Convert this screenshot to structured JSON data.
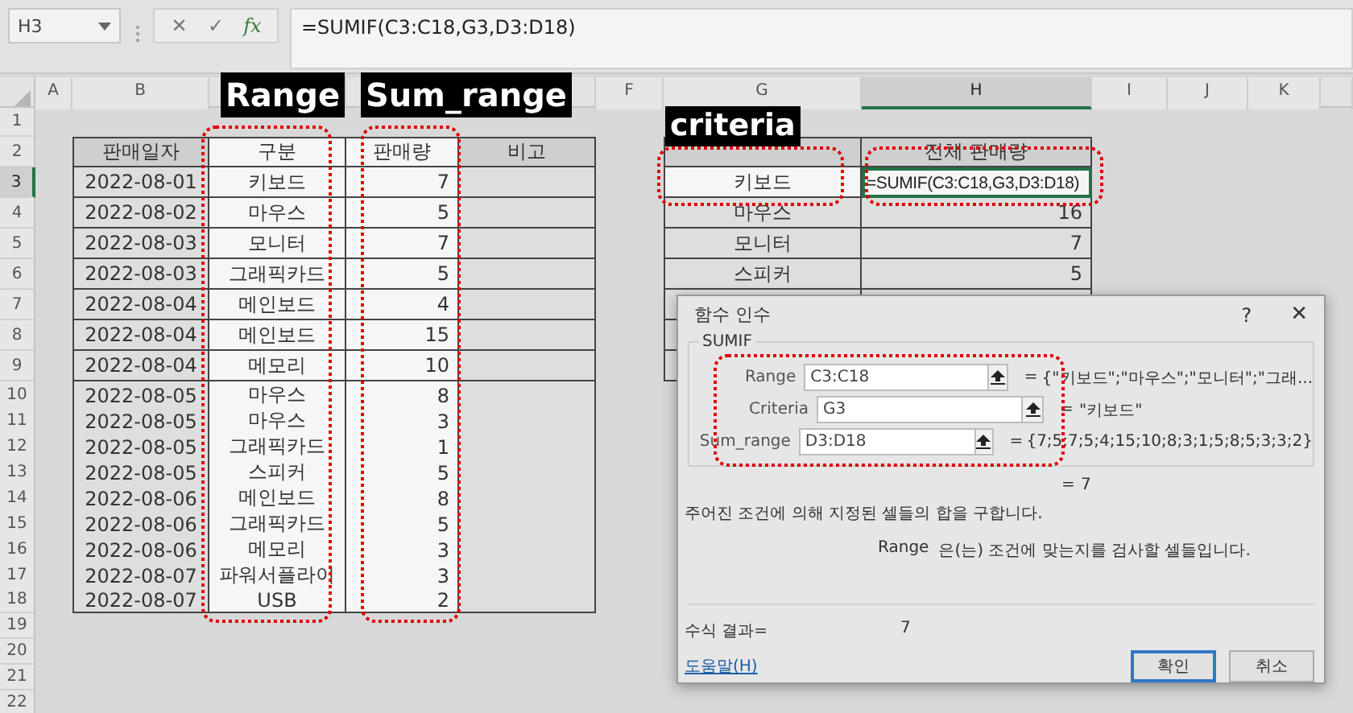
{
  "formula_bar": {
    "name_box": "H3",
    "cancel": "✕",
    "enter": "✓",
    "insert_function": "fx",
    "formula": "=SUMIF(C3:C18,G3,D3:D18)"
  },
  "columns": [
    {
      "label": "A",
      "selected": false
    },
    {
      "label": "B",
      "selected": false
    },
    {
      "label": "F",
      "selected": false
    },
    {
      "label": "G",
      "selected": false
    },
    {
      "label": "H",
      "selected": true
    },
    {
      "label": "I",
      "selected": false
    },
    {
      "label": "J",
      "selected": false
    },
    {
      "label": "K",
      "selected": false
    }
  ],
  "rows": [
    {
      "label": "1",
      "selected": false
    },
    {
      "label": "2",
      "selected": false
    },
    {
      "label": "3",
      "selected": true
    },
    {
      "label": "4",
      "selected": false
    },
    {
      "label": "5",
      "selected": false
    },
    {
      "label": "6",
      "selected": false
    },
    {
      "label": "7",
      "selected": false
    },
    {
      "label": "8",
      "selected": false
    },
    {
      "label": "9",
      "selected": false
    },
    {
      "label": "10",
      "selected": false
    },
    {
      "label": "11",
      "selected": false
    },
    {
      "label": "12",
      "selected": false
    },
    {
      "label": "13",
      "selected": false
    },
    {
      "label": "14",
      "selected": false
    },
    {
      "label": "15",
      "selected": false
    },
    {
      "label": "16",
      "selected": false
    },
    {
      "label": "17",
      "selected": false
    },
    {
      "label": "18",
      "selected": false
    },
    {
      "label": "19",
      "selected": false
    },
    {
      "label": "20",
      "selected": false
    },
    {
      "label": "21",
      "selected": false
    },
    {
      "label": "22",
      "selected": false
    }
  ],
  "sales_table": {
    "columns": [
      {
        "header": "판매일자",
        "referenced": false
      },
      {
        "header": "구분",
        "referenced": true
      },
      {
        "header": "판매량",
        "referenced": true
      },
      {
        "header": "비고",
        "referenced": false
      }
    ],
    "rows": [
      [
        "2022-08-01",
        "키보드",
        "7"
      ],
      [
        "2022-08-02",
        "마우스",
        "5"
      ],
      [
        "2022-08-03",
        "모니터",
        "7"
      ],
      [
        "2022-08-03",
        "그래픽카드",
        "5"
      ],
      [
        "2022-08-04",
        "메인보드",
        "4"
      ],
      [
        "2022-08-04",
        "메인보드",
        "15"
      ],
      [
        "2022-08-04",
        "메모리",
        "10"
      ],
      [
        "2022-08-05",
        "마우스",
        "8"
      ],
      [
        "2022-08-05",
        "마우스",
        "3"
      ],
      [
        "2022-08-05",
        "그래픽카드",
        "1"
      ],
      [
        "2022-08-05",
        "스피커",
        "5"
      ],
      [
        "2022-08-06",
        "메인보드",
        "8"
      ],
      [
        "2022-08-06",
        "그래픽카드",
        "5"
      ],
      [
        "2022-08-06",
        "메모리",
        "3"
      ],
      [
        "2022-08-07",
        "파워서플라이",
        "3"
      ],
      [
        "2022-08-07",
        "USB",
        "2"
      ]
    ]
  },
  "summary_table": {
    "headers": [
      "전체 판매량"
    ],
    "rows": [
      [
        {
          "text": "키보드",
          "referenced": true,
          "editing": false
        },
        {
          "text": "=SUMIF(C3:C18,G3,D3:D18)",
          "referenced": false,
          "editing": true
        }
      ],
      [
        {
          "text": "마우스",
          "referenced": false,
          "editing": false
        },
        {
          "text": "16",
          "referenced": false,
          "editing": false
        }
      ],
      [
        {
          "text": "모니터",
          "referenced": false,
          "editing": false
        },
        {
          "text": "7",
          "referenced": false,
          "editing": false
        }
      ],
      [
        {
          "text": "스피커",
          "referenced": false,
          "editing": false
        },
        {
          "text": "5",
          "referenced": false,
          "editing": false
        }
      ]
    ]
  },
  "annotations": [
    {
      "text": "Range",
      "kind": "column"
    },
    {
      "text": "Sum_range",
      "kind": "column"
    },
    {
      "text": "criteria",
      "kind": "cell"
    }
  ],
  "dialog": {
    "title": "함수 인수",
    "help": "?",
    "close": "✕",
    "function": "SUMIF",
    "arguments": [
      {
        "label": "Range",
        "value": "C3:C18",
        "sign": "=",
        "result": "{\"키보드\";\"마우스\";\"모니터\";\"그래..."
      },
      {
        "label": "Criteria",
        "value": "G3",
        "sign": "=",
        "result": "\"키보드\""
      },
      {
        "label": "Sum_range",
        "value": "D3:D18",
        "sign": "=",
        "result": "{7;5;7;5;4;15;10;8;3;1;5;8;5;3;3;2}"
      }
    ],
    "total": {
      "sign": "=",
      "value": "7"
    },
    "description": "주어진 조건에 의해 지정된 셀들의 합을 구합니다.",
    "argument_help": {
      "name": "Range",
      "text": "은(는) 조건에 맞는지를 검사할 셀들입니다."
    },
    "formula_result": {
      "label": "수식 결과=",
      "value": "7"
    },
    "help_link": "도움말(H)",
    "buttons": [
      {
        "label": "확인",
        "default": true
      },
      {
        "label": "취소",
        "default": false
      }
    ]
  }
}
